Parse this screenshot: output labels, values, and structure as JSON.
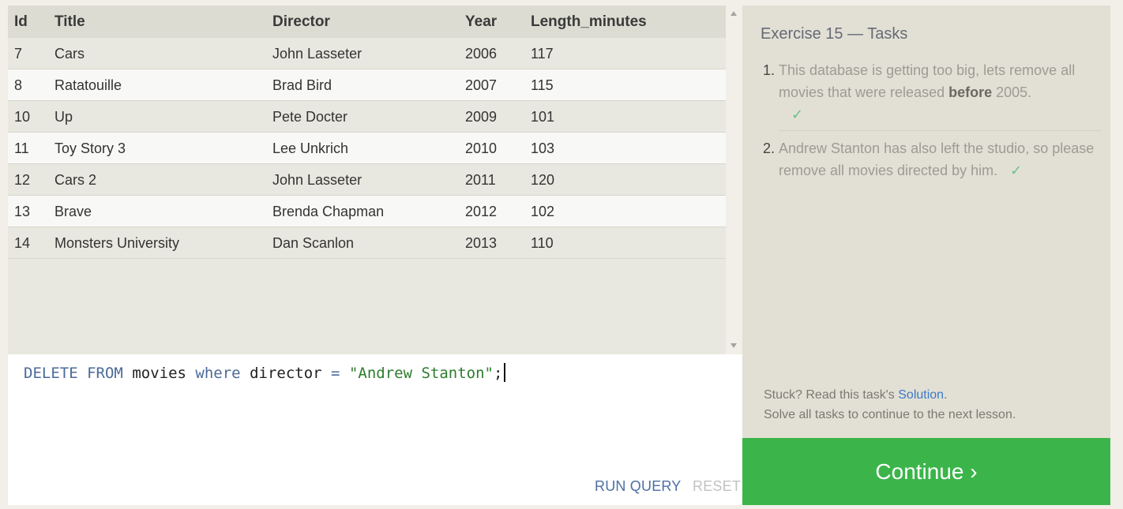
{
  "table": {
    "headers": [
      "Id",
      "Title",
      "Director",
      "Year",
      "Length_minutes"
    ],
    "rows": [
      [
        "7",
        "Cars",
        "John Lasseter",
        "2006",
        "117"
      ],
      [
        "8",
        "Ratatouille",
        "Brad Bird",
        "2007",
        "115"
      ],
      [
        "10",
        "Up",
        "Pete Docter",
        "2009",
        "101"
      ],
      [
        "11",
        "Toy Story 3",
        "Lee Unkrich",
        "2010",
        "103"
      ],
      [
        "12",
        "Cars 2",
        "John Lasseter",
        "2011",
        "120"
      ],
      [
        "13",
        "Brave",
        "Brenda Chapman",
        "2012",
        "102"
      ],
      [
        "14",
        "Monsters University",
        "Dan Scanlon",
        "2013",
        "110"
      ]
    ]
  },
  "editor": {
    "kw_delete": "DELETE",
    "kw_from": "FROM",
    "table_name": "movies",
    "kw_where": "where",
    "column": "director",
    "op": "=",
    "value": "\"Andrew Stanton\"",
    "terminator": ";",
    "run_label": "RUN QUERY",
    "reset_label": "RESET"
  },
  "tasks": {
    "title": "Exercise 15 — Tasks",
    "items": [
      {
        "num": "1.",
        "pre": "This database is getting too big, lets remove all movies that were released ",
        "bold": "before",
        "post": " 2005.",
        "check": "✓"
      },
      {
        "num": "2.",
        "pre": "Andrew Stanton has also left the studio, so please remove all movies directed by him.",
        "bold": "",
        "post": "",
        "check": "✓"
      }
    ],
    "stuck_prefix": "Stuck? Read this task's ",
    "solution_link": "Solution",
    "stuck_suffix": ".",
    "solve_all": "Solve all tasks to continue to the next lesson."
  },
  "continue_label": "Continue ›",
  "colors": {
    "continue_bg": "#3bb54a",
    "keyword": "#4b6a98",
    "string": "#2d7c2d",
    "link": "#3c78c9"
  }
}
